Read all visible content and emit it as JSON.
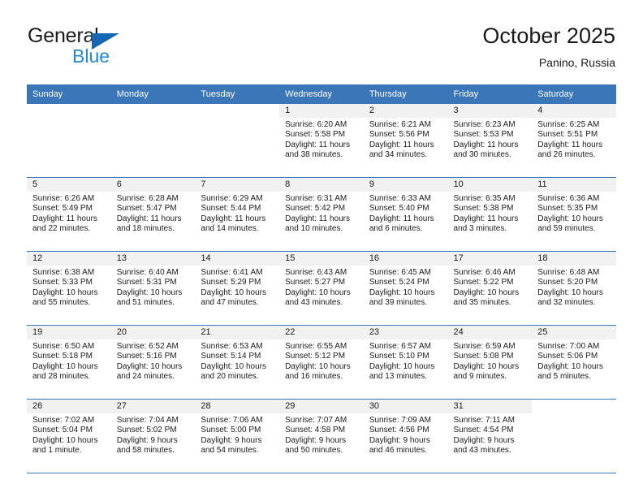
{
  "brand": {
    "name_part1": "General",
    "name_part2": "Blue",
    "logo_icon": "triangle-flag-icon",
    "color_primary": "#1567b3",
    "color_secondary": "#1f8ad6"
  },
  "header": {
    "title": "October 2025",
    "subtitle": "Panino, Russia"
  },
  "theme": {
    "header_row_bg": "#3b76b9",
    "daynum_strip_bg": "#f1f1f1",
    "grid_line": "#3b76b9",
    "text": "#1b1b1b"
  },
  "weekdays": [
    "Sunday",
    "Monday",
    "Tuesday",
    "Wednesday",
    "Thursday",
    "Friday",
    "Saturday"
  ],
  "weeks": [
    [
      {
        "day": "",
        "blank": true,
        "lines": []
      },
      {
        "day": "",
        "blank": true,
        "lines": []
      },
      {
        "day": "",
        "blank": true,
        "lines": []
      },
      {
        "day": "1",
        "lines": [
          "Sunrise: 6:20 AM",
          "Sunset: 5:58 PM",
          "Daylight: 11 hours",
          "and 38 minutes."
        ]
      },
      {
        "day": "2",
        "lines": [
          "Sunrise: 6:21 AM",
          "Sunset: 5:56 PM",
          "Daylight: 11 hours",
          "and 34 minutes."
        ]
      },
      {
        "day": "3",
        "lines": [
          "Sunrise: 6:23 AM",
          "Sunset: 5:53 PM",
          "Daylight: 11 hours",
          "and 30 minutes."
        ]
      },
      {
        "day": "4",
        "lines": [
          "Sunrise: 6:25 AM",
          "Sunset: 5:51 PM",
          "Daylight: 11 hours",
          "and 26 minutes."
        ]
      }
    ],
    [
      {
        "day": "5",
        "lines": [
          "Sunrise: 6:26 AM",
          "Sunset: 5:49 PM",
          "Daylight: 11 hours",
          "and 22 minutes."
        ]
      },
      {
        "day": "6",
        "lines": [
          "Sunrise: 6:28 AM",
          "Sunset: 5:47 PM",
          "Daylight: 11 hours",
          "and 18 minutes."
        ]
      },
      {
        "day": "7",
        "lines": [
          "Sunrise: 6:29 AM",
          "Sunset: 5:44 PM",
          "Daylight: 11 hours",
          "and 14 minutes."
        ]
      },
      {
        "day": "8",
        "lines": [
          "Sunrise: 6:31 AM",
          "Sunset: 5:42 PM",
          "Daylight: 11 hours",
          "and 10 minutes."
        ]
      },
      {
        "day": "9",
        "lines": [
          "Sunrise: 6:33 AM",
          "Sunset: 5:40 PM",
          "Daylight: 11 hours",
          "and 6 minutes."
        ]
      },
      {
        "day": "10",
        "lines": [
          "Sunrise: 6:35 AM",
          "Sunset: 5:38 PM",
          "Daylight: 11 hours",
          "and 3 minutes."
        ]
      },
      {
        "day": "11",
        "lines": [
          "Sunrise: 6:36 AM",
          "Sunset: 5:35 PM",
          "Daylight: 10 hours",
          "and 59 minutes."
        ]
      }
    ],
    [
      {
        "day": "12",
        "lines": [
          "Sunrise: 6:38 AM",
          "Sunset: 5:33 PM",
          "Daylight: 10 hours",
          "and 55 minutes."
        ]
      },
      {
        "day": "13",
        "lines": [
          "Sunrise: 6:40 AM",
          "Sunset: 5:31 PM",
          "Daylight: 10 hours",
          "and 51 minutes."
        ]
      },
      {
        "day": "14",
        "lines": [
          "Sunrise: 6:41 AM",
          "Sunset: 5:29 PM",
          "Daylight: 10 hours",
          "and 47 minutes."
        ]
      },
      {
        "day": "15",
        "lines": [
          "Sunrise: 6:43 AM",
          "Sunset: 5:27 PM",
          "Daylight: 10 hours",
          "and 43 minutes."
        ]
      },
      {
        "day": "16",
        "lines": [
          "Sunrise: 6:45 AM",
          "Sunset: 5:24 PM",
          "Daylight: 10 hours",
          "and 39 minutes."
        ]
      },
      {
        "day": "17",
        "lines": [
          "Sunrise: 6:46 AM",
          "Sunset: 5:22 PM",
          "Daylight: 10 hours",
          "and 35 minutes."
        ]
      },
      {
        "day": "18",
        "lines": [
          "Sunrise: 6:48 AM",
          "Sunset: 5:20 PM",
          "Daylight: 10 hours",
          "and 32 minutes."
        ]
      }
    ],
    [
      {
        "day": "19",
        "lines": [
          "Sunrise: 6:50 AM",
          "Sunset: 5:18 PM",
          "Daylight: 10 hours",
          "and 28 minutes."
        ]
      },
      {
        "day": "20",
        "lines": [
          "Sunrise: 6:52 AM",
          "Sunset: 5:16 PM",
          "Daylight: 10 hours",
          "and 24 minutes."
        ]
      },
      {
        "day": "21",
        "lines": [
          "Sunrise: 6:53 AM",
          "Sunset: 5:14 PM",
          "Daylight: 10 hours",
          "and 20 minutes."
        ]
      },
      {
        "day": "22",
        "lines": [
          "Sunrise: 6:55 AM",
          "Sunset: 5:12 PM",
          "Daylight: 10 hours",
          "and 16 minutes."
        ]
      },
      {
        "day": "23",
        "lines": [
          "Sunrise: 6:57 AM",
          "Sunset: 5:10 PM",
          "Daylight: 10 hours",
          "and 13 minutes."
        ]
      },
      {
        "day": "24",
        "lines": [
          "Sunrise: 6:59 AM",
          "Sunset: 5:08 PM",
          "Daylight: 10 hours",
          "and 9 minutes."
        ]
      },
      {
        "day": "25",
        "lines": [
          "Sunrise: 7:00 AM",
          "Sunset: 5:06 PM",
          "Daylight: 10 hours",
          "and 5 minutes."
        ]
      }
    ],
    [
      {
        "day": "26",
        "lines": [
          "Sunrise: 7:02 AM",
          "Sunset: 5:04 PM",
          "Daylight: 10 hours",
          "and 1 minute."
        ]
      },
      {
        "day": "27",
        "lines": [
          "Sunrise: 7:04 AM",
          "Sunset: 5:02 PM",
          "Daylight: 9 hours",
          "and 58 minutes."
        ]
      },
      {
        "day": "28",
        "lines": [
          "Sunrise: 7:06 AM",
          "Sunset: 5:00 PM",
          "Daylight: 9 hours",
          "and 54 minutes."
        ]
      },
      {
        "day": "29",
        "lines": [
          "Sunrise: 7:07 AM",
          "Sunset: 4:58 PM",
          "Daylight: 9 hours",
          "and 50 minutes."
        ]
      },
      {
        "day": "30",
        "lines": [
          "Sunrise: 7:09 AM",
          "Sunset: 4:56 PM",
          "Daylight: 9 hours",
          "and 46 minutes."
        ]
      },
      {
        "day": "31",
        "lines": [
          "Sunrise: 7:11 AM",
          "Sunset: 4:54 PM",
          "Daylight: 9 hours",
          "and 43 minutes."
        ]
      },
      {
        "day": "",
        "blank": true,
        "lines": []
      }
    ]
  ]
}
